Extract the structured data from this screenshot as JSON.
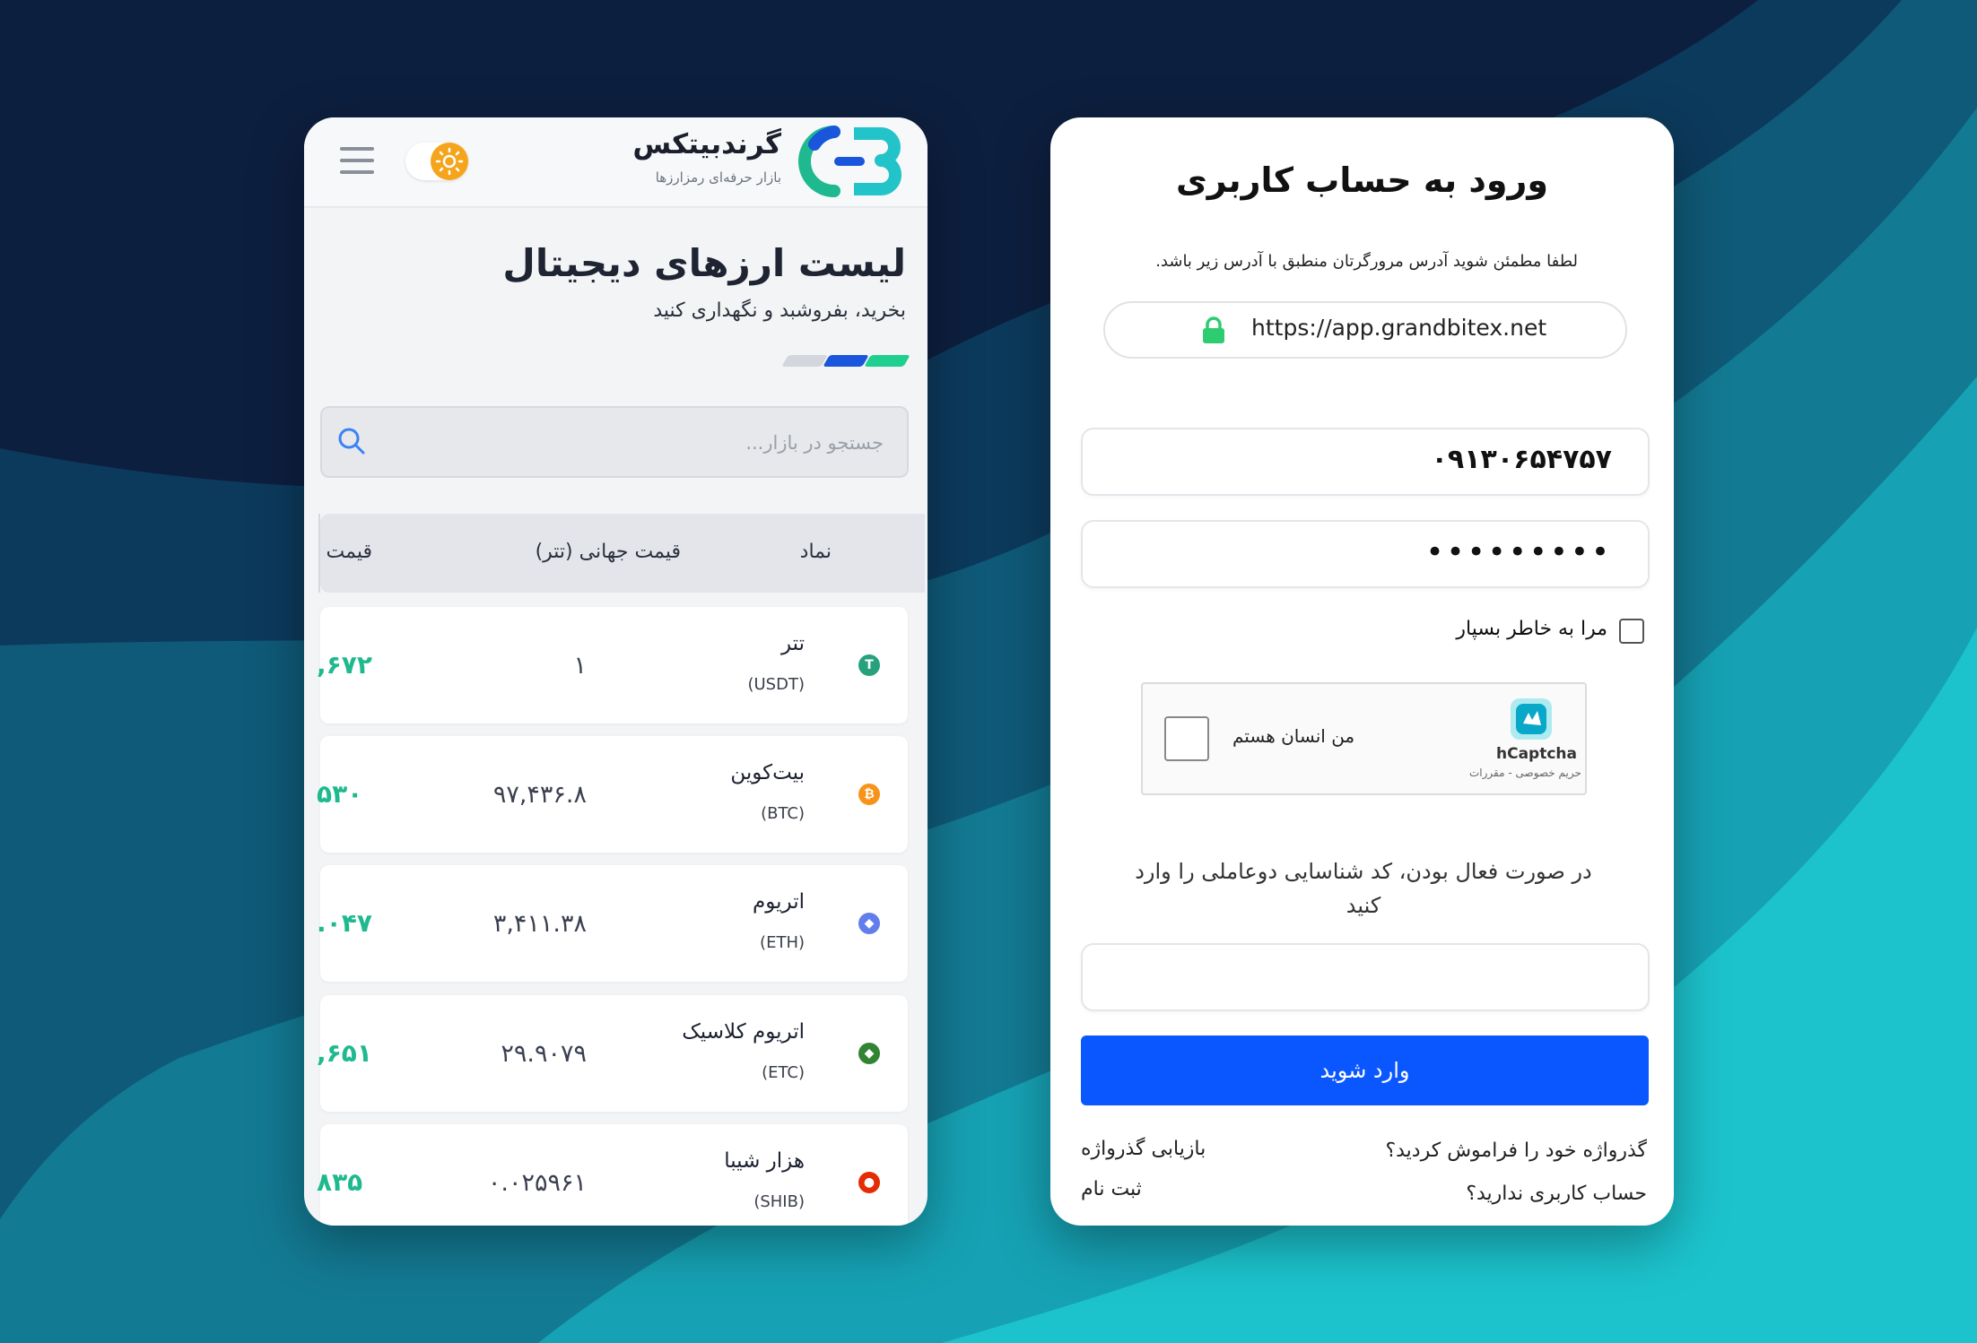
{
  "left_app": {
    "brand": {
      "name": "گرندبیتکس",
      "tagline": "بازار حرفه‌ای رمزارزها"
    },
    "page": {
      "title": "لیست ارزهای دیجیتال",
      "subtitle": "بخرید، بفروشبد و نگهداری کنید"
    },
    "search": {
      "placeholder": "جستجو در بازار..."
    },
    "table": {
      "headers": [
        "نماد",
        "قیمت جهانی (تتر)",
        "قیمت"
      ],
      "rows": [
        {
          "name": "تتر",
          "symbol": "(USDT)",
          "global_price": "۱",
          "local_price": "۶۷۲,",
          "icon": "tether-icon",
          "color": "#26a17b"
        },
        {
          "name": "بیت‌کوین",
          "symbol": "(BTC)",
          "global_price": "۹۷,۴۳۶.۸",
          "local_price": "۵۳۰",
          "icon": "bitcoin-icon",
          "color": "#f7931a"
        },
        {
          "name": "اتریوم",
          "symbol": "(ETH)",
          "global_price": "۳,۴۱۱.۳۸",
          "local_price": "۰۴۷.",
          "icon": "ethereum-icon",
          "color": "#627eea"
        },
        {
          "name": "اتریوم کلاسیک",
          "symbol": "(ETC)",
          "global_price": "۲۹.۹۰۷۹",
          "local_price": "۶۵۱,",
          "icon": "ethereum-classic-icon",
          "color": "#328332"
        },
        {
          "name": "هزار شیبا",
          "symbol": "(SHIB)",
          "global_price": "۰.۰۲۵۹۶۱",
          "local_price": "۸۳۵",
          "icon": "shiba-icon",
          "color": "#e42d04"
        }
      ]
    },
    "colors": {
      "accent_green": "#1fb98f",
      "accent_blue": "#1a56db",
      "sun": "#f5a51c"
    }
  },
  "right_app": {
    "title": "ورود به حساب کاربری",
    "address_note": "لطفا مطمئن شوید آدرس مرورگرتان منطبق با آدرس زیر باشد.",
    "url": "https://app.grandbitex.net",
    "phone_value": "۰۹۱۳۰۶۵۴۷۵۷",
    "password_masked": "•••••••••",
    "remember_label": "مرا به خاطر بسپار",
    "captcha": {
      "label": "من انسان هستم",
      "brand": "hCaptcha",
      "terms": "حریم خصوصی - مقررات"
    },
    "twofa_text": "در صورت فعال بودن، کد شناسایی دوعاملی را وارد کنید",
    "submit_label": "وارد شوید",
    "links": {
      "forgot_question": "گذرواژه خود را فراموش کردید؟",
      "forgot_action": "بازیابی گذرواژه",
      "no_account_question": "حساب کاربری ندارید؟",
      "register_action": "ثبت نام"
    },
    "colors": {
      "submit": "#0b57ff",
      "lock": "#2ecc71"
    }
  }
}
